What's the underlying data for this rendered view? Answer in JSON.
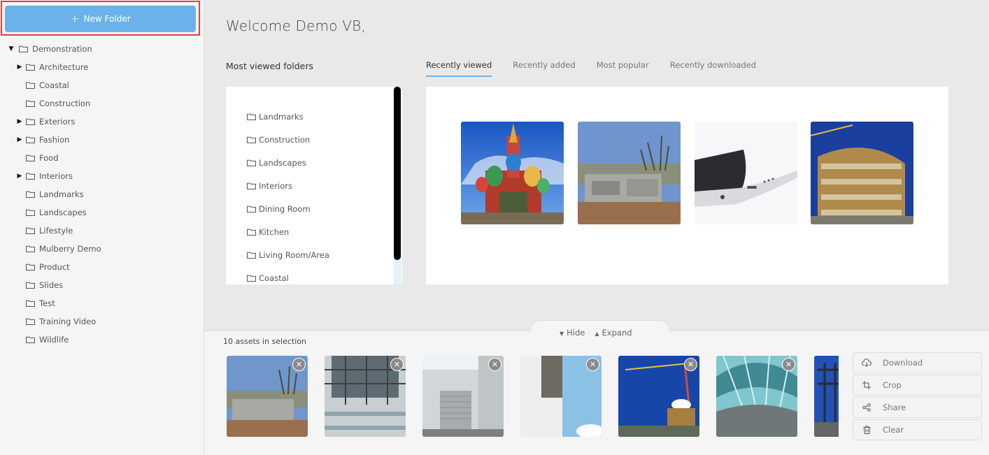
{
  "sidebar": {
    "new_folder_label": "New Folder",
    "tree": [
      {
        "label": "Demonstration",
        "level": 0,
        "expandable": true,
        "expanded": true
      },
      {
        "label": "Architecture",
        "level": 1,
        "expandable": true
      },
      {
        "label": "Coastal",
        "level": 1,
        "expandable": false
      },
      {
        "label": "Construction",
        "level": 1,
        "expandable": false
      },
      {
        "label": "Exteriors",
        "level": 1,
        "expandable": true
      },
      {
        "label": "Fashion",
        "level": 1,
        "expandable": true
      },
      {
        "label": "Food",
        "level": 1,
        "expandable": false
      },
      {
        "label": "Interiors",
        "level": 1,
        "expandable": true
      },
      {
        "label": "Landmarks",
        "level": 1,
        "expandable": false
      },
      {
        "label": "Landscapes",
        "level": 1,
        "expandable": false
      },
      {
        "label": "Lifestyle",
        "level": 1,
        "expandable": false
      },
      {
        "label": "Mulberry Demo",
        "level": 1,
        "expandable": false
      },
      {
        "label": "Product",
        "level": 1,
        "expandable": false
      },
      {
        "label": "Slides",
        "level": 1,
        "expandable": false
      },
      {
        "label": "Test",
        "level": 1,
        "expandable": false
      },
      {
        "label": "Training Video",
        "level": 1,
        "expandable": false
      },
      {
        "label": "Wildlife",
        "level": 1,
        "expandable": false
      }
    ]
  },
  "main": {
    "welcome": "Welcome Demo VB,",
    "most_viewed_title": "Most viewed folders",
    "most_viewed": [
      "Landmarks",
      "Construction",
      "Landscapes",
      "Interiors",
      "Dining Room",
      "Kitchen",
      "Living Room/Area",
      "Coastal"
    ],
    "tabs": [
      "Recently viewed",
      "Recently added",
      "Most popular",
      "Recently downloaded"
    ],
    "active_tab": "Recently viewed",
    "recent_thumbs": [
      "cathedral",
      "construction-site",
      "smartphone",
      "building-construction"
    ]
  },
  "tray": {
    "hide_label": "Hide",
    "expand_label": "Expand",
    "selection_count": "10 assets in selection",
    "selection_thumbs": [
      "construction-site",
      "scaffolding",
      "garage-door",
      "white-wall-sky",
      "crane-building",
      "glass-canopy",
      "steel-frame"
    ],
    "actions": [
      {
        "label": "Download",
        "icon": "cloud-download-icon"
      },
      {
        "label": "Crop",
        "icon": "crop-icon"
      },
      {
        "label": "Share",
        "icon": "share-icon"
      },
      {
        "label": "Clear",
        "icon": "trash-icon"
      }
    ]
  },
  "colors": {
    "accent": "#6cb2ea",
    "highlight_border": "#e0403f"
  }
}
